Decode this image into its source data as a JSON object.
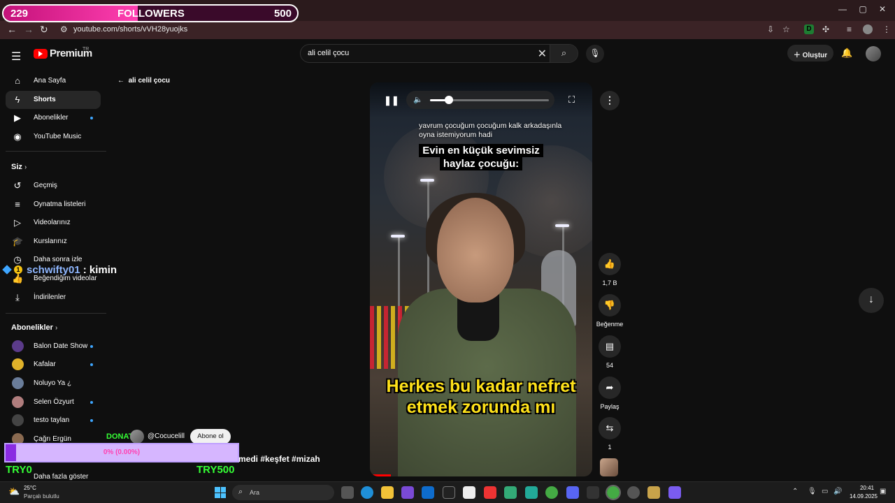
{
  "browser": {
    "url": "youtube.com/shorts/vVH28yuojks"
  },
  "followers": {
    "current": "229",
    "label": "FOLLOWERS",
    "goal": "500",
    "progress": 0.458
  },
  "header": {
    "logo_text": "Premium",
    "logo_region": "TR",
    "search_value": "ali celil çocu",
    "create_label": "Oluştur"
  },
  "sidebar": {
    "main": [
      {
        "label": "Ana Sayfa",
        "icon": "home-icon"
      },
      {
        "label": "Shorts",
        "icon": "shorts-icon"
      },
      {
        "label": "Abonelikler",
        "icon": "subscriptions-icon"
      },
      {
        "label": "YouTube Music",
        "icon": "music-icon"
      }
    ],
    "you_heading": "Siz",
    "you": [
      {
        "label": "Geçmiş"
      },
      {
        "label": "Oynatma listeleri"
      },
      {
        "label": "Videolarınız"
      },
      {
        "label": "Kurslarınız"
      },
      {
        "label": "Daha sonra izle"
      },
      {
        "label": "Beğendiğim videolar"
      },
      {
        "label": "İndirilenler"
      }
    ],
    "subs_heading": "Abonelikler",
    "subs": [
      {
        "label": "Balon Date Show"
      },
      {
        "label": "Kafalar"
      },
      {
        "label": "Noluyo Ya ¿"
      },
      {
        "label": "Selen Özyurt"
      },
      {
        "label": "testo taylan"
      },
      {
        "label": "Çağrı Ergün"
      }
    ],
    "show_more": "Daha fazla göster"
  },
  "shorts": {
    "back_label": "ali celil çocu",
    "volume": 0.16,
    "caption_small": "yavrum çocuğum çocuğum kalk arkadaşınla oyna istemiyorum hadi",
    "caption_box_line1": "Evin en küçük sevimsiz",
    "caption_box_line2": "haylaz çocuğu:",
    "caption_big": "Herkes bu kadar nefret etmek zorunda mı",
    "hashtags": "medi #keşfet #mizah",
    "actions": {
      "likes": "1,7 B",
      "dislike_label": "Beğenme",
      "comments": "54",
      "share_label": "Paylaş",
      "remix": "1"
    }
  },
  "chat": {
    "badge": "1",
    "user": "schwifty01",
    "message": ": kimin"
  },
  "donate": {
    "label": "DONATE",
    "channel": "@Cocucelill",
    "subscribe_label": "Abone ol",
    "percent": "0% (0.00%)",
    "progress": 0.045,
    "min": "TRY0",
    "max": "TRY500"
  },
  "taskbar": {
    "temp": "25°C",
    "weather": "Parçalı bulutlu",
    "search_placeholder": "Ara",
    "time": "20:41",
    "date": "14.09.2025"
  },
  "colors": {
    "accent_blue": "#3ea6ff",
    "yt_red": "#ff0000",
    "donate_green": "#35ff35",
    "followers_pink": "#ff3fb0",
    "caption_yellow": "#ffe21a"
  }
}
